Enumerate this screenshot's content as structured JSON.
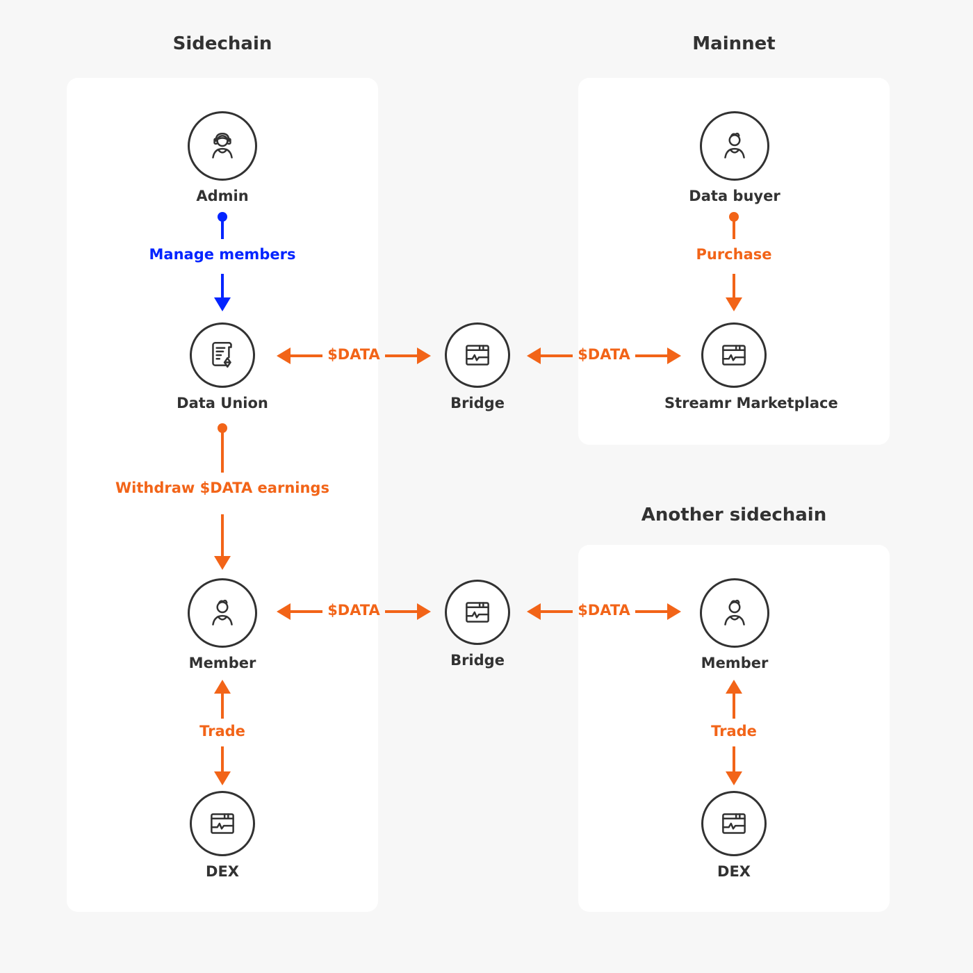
{
  "colors": {
    "accent_orange": "#f26418",
    "accent_blue": "#0324ff",
    "text": "#323232",
    "panel": "#ffffff",
    "background": "#f7f7f7"
  },
  "sections": {
    "sidechain": "Sidechain",
    "mainnet": "Mainnet",
    "another_sidechain": "Another sidechain"
  },
  "nodes": {
    "admin": {
      "label": "Admin",
      "icon": "admin-headset-icon"
    },
    "data_union": {
      "label": "Data Union",
      "icon": "contract-document-icon"
    },
    "member": {
      "label": "Member",
      "icon": "user-icon"
    },
    "dex": {
      "label": "DEX",
      "icon": "app-window-icon"
    },
    "bridge_top": {
      "label": "Bridge",
      "icon": "app-window-icon"
    },
    "bridge_bottom": {
      "label": "Bridge",
      "icon": "app-window-icon"
    },
    "data_buyer": {
      "label": "Data buyer",
      "icon": "user-icon"
    },
    "marketplace": {
      "label": "Streamr Marketplace",
      "icon": "app-window-icon"
    },
    "member2": {
      "label": "Member",
      "icon": "user-icon"
    },
    "dex2": {
      "label": "DEX",
      "icon": "app-window-icon"
    }
  },
  "edges": {
    "manage_members": "Manage members",
    "purchase": "Purchase",
    "withdraw": "Withdraw $DATA earnings",
    "trade_left": "Trade",
    "trade_right": "Trade",
    "data_du_bridge": "$DATA",
    "data_bridge_market": "$DATA",
    "data_member_bridge": "$DATA",
    "data_bridge_member2": "$DATA"
  }
}
